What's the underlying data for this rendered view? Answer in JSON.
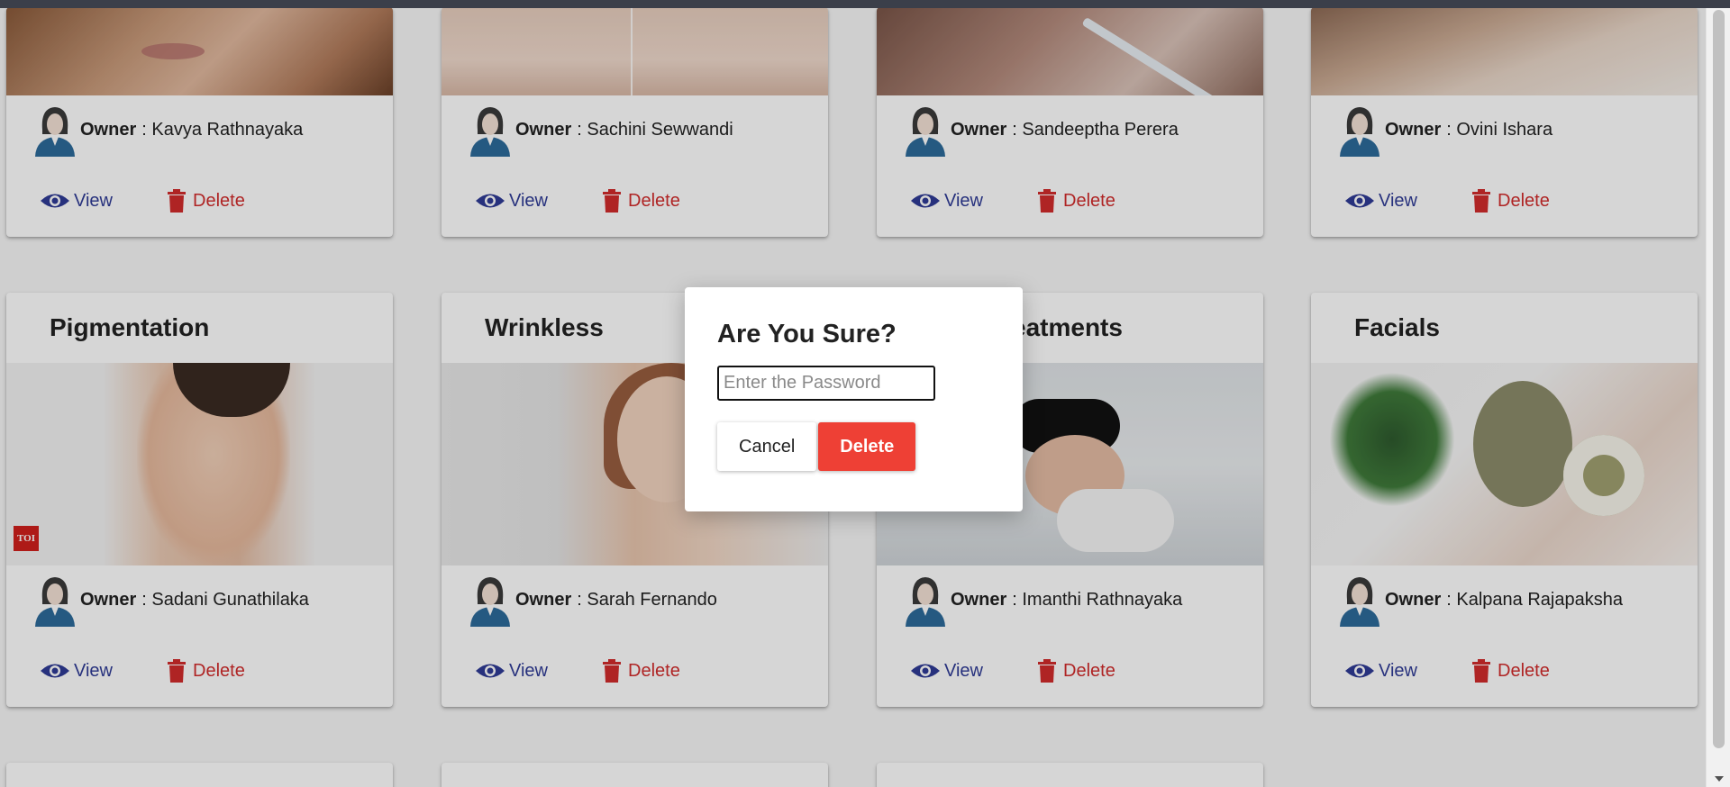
{
  "row1": [
    {
      "owner_label": "Owner",
      "owner": ": Kavya Rathnayaka",
      "view": "View",
      "delete": "Delete"
    },
    {
      "owner_label": "Owner",
      "owner": ": Sachini Sewwandi",
      "view": "View",
      "delete": "Delete"
    },
    {
      "owner_label": "Owner",
      "owner": ": Sandeeptha Perera",
      "view": "View",
      "delete": "Delete"
    },
    {
      "owner_label": "Owner",
      "owner": ": Ovini Ishara",
      "view": "View",
      "delete": "Delete"
    }
  ],
  "row2": [
    {
      "title": "Pigmentation",
      "owner_label": "Owner",
      "owner": ": Sadani Gunathilaka",
      "view": "View",
      "delete": "Delete",
      "badge": "TOI"
    },
    {
      "title": "Wrinkless",
      "owner_label": "Owner",
      "owner": ": Sarah Fernando",
      "view": "View",
      "delete": "Delete"
    },
    {
      "title": "eatments",
      "owner_label": "Owner",
      "owner": ": Imanthi Rathnayaka",
      "view": "View",
      "delete": "Delete"
    },
    {
      "title": "Facials",
      "owner_label": "Owner",
      "owner": ": Kalpana Rajapaksha",
      "view": "View",
      "delete": "Delete"
    }
  ],
  "modal": {
    "title": "Are You Sure?",
    "password_placeholder": "Enter the Password",
    "cancel": "Cancel",
    "confirm": "Delete"
  },
  "colors": {
    "view": "#2f3b96",
    "delete": "#d12b2b",
    "confirm_bg": "#ee4035"
  },
  "icons": [
    "eye-icon",
    "trash-icon",
    "avatar-icon"
  ]
}
